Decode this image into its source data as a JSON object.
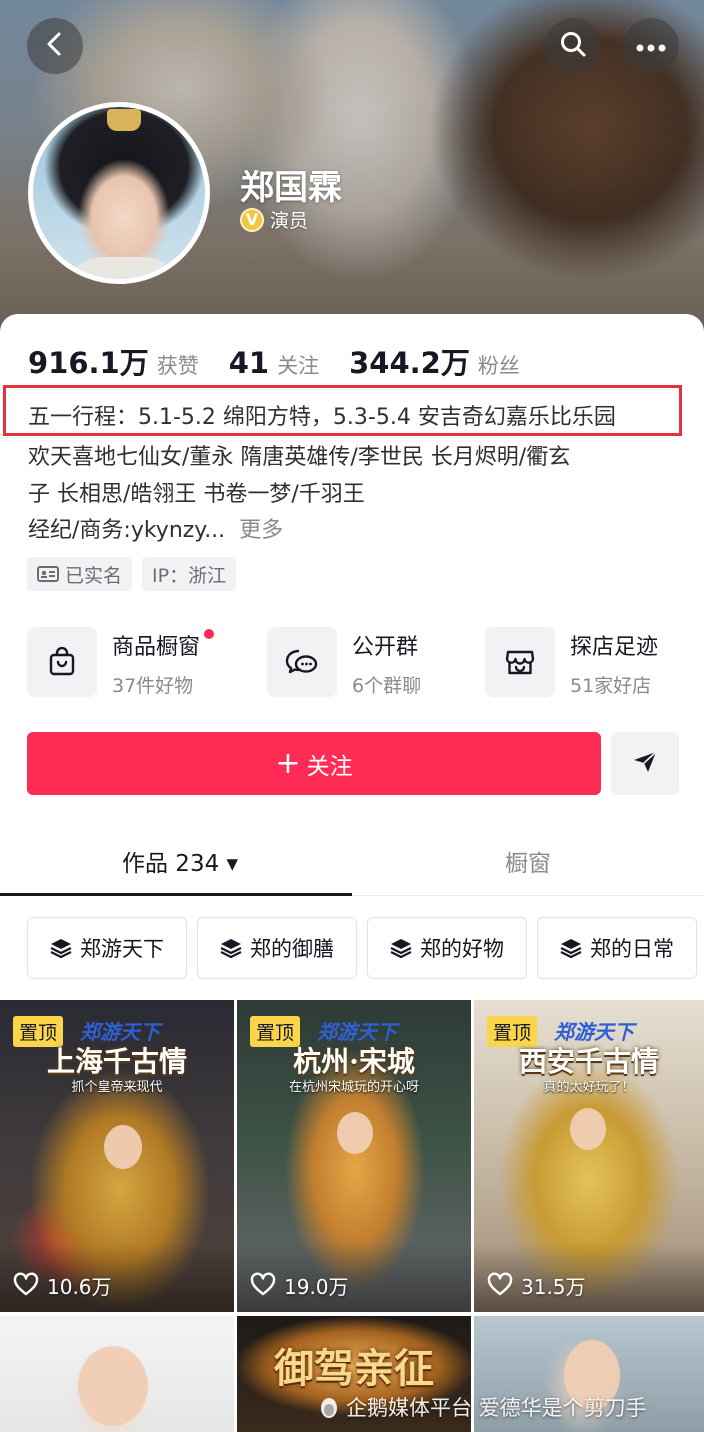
{
  "header": {
    "name": "郑国霖",
    "verified_label": "演员",
    "verified_badge": "V",
    "icons": [
      "back-arrow-icon",
      "search-icon",
      "more-dots-icon"
    ]
  },
  "stats": [
    {
      "value": "916.1万",
      "label": "获赞"
    },
    {
      "value": "41",
      "label": "关注"
    },
    {
      "value": "344.2万",
      "label": "粉丝"
    }
  ],
  "bio": {
    "line1": "五一行程：5.1-5.2 绵阳方特，5.3-5.4 安吉奇幻嘉乐比乐园",
    "line2": "欢天喜地七仙女/董永   隋唐英雄传/李世民   长月烬明/衢玄",
    "line3": "子   长相思/皓翎王   书卷一梦/千羽王",
    "line4": "经纪/商务:ykynzy...",
    "more": "更多"
  },
  "tags": [
    {
      "label": "已实名",
      "icon": "id-card-icon"
    },
    {
      "label": "IP：浙江",
      "icon": ""
    }
  ],
  "entries": [
    {
      "title": "商品橱窗",
      "sub": "37件好物",
      "icon": "shopping-bag-icon",
      "dot": true
    },
    {
      "title": "公开群",
      "sub": "6个群聊",
      "icon": "chat-bubbles-icon",
      "dot": false
    },
    {
      "title": "探店足迹",
      "sub": "51家好店",
      "icon": "store-icon",
      "dot": false
    }
  ],
  "actions": {
    "follow_label": "关注",
    "follow_plus": "+",
    "share_icon": "send-icon",
    "accent": "#fe2c55"
  },
  "tabs": {
    "works": "作品 234 ▾",
    "window": "橱窗"
  },
  "collections": [
    "郑游天下",
    "郑的御膳",
    "郑的好物",
    "郑的日常"
  ],
  "videos": [
    {
      "pin": "置顶",
      "brand": "郑游天下",
      "title": "上海千古情",
      "subtitle": "抓个皇帝来现代",
      "likes": "10.6万"
    },
    {
      "pin": "置顶",
      "brand": "郑游天下",
      "title": "杭州·宋城",
      "subtitle": "在杭州宋城玩的开心呀",
      "likes": "19.0万"
    },
    {
      "pin": "置顶",
      "brand": "郑游天下",
      "title": "西安千古情",
      "subtitle": "真的太好玩了！",
      "likes": "31.5万"
    },
    {
      "title": "御驾亲征"
    }
  ],
  "watermark": "企鹅媒体平台 爱德华是个剪刀手",
  "colors": {
    "brand_red": "#fe2c55",
    "highlight_box": "#e8303a",
    "pin_yellow": "#fbd54a",
    "verified_gold": "#f4c542"
  }
}
